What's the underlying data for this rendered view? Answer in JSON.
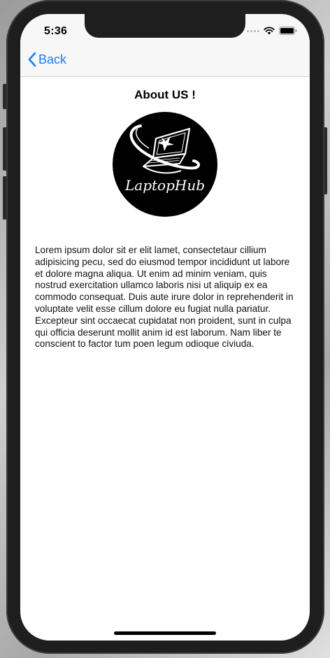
{
  "status_bar": {
    "time": "5:36"
  },
  "nav": {
    "back_label": "Back"
  },
  "page": {
    "title": "About US !",
    "logo_text": "LaptopHub",
    "description": "Lorem ipsum dolor sit er elit lamet, consectetaur cillium adipisicing pecu, sed do eiusmod tempor incididunt ut labore et dolore magna aliqua. Ut enim ad minim veniam, quis nostrud exercitation ullamco laboris nisi ut aliquip ex ea commodo consequat. Duis aute irure dolor in reprehenderit in voluptate velit esse cillum dolore eu fugiat nulla pariatur. Excepteur sint occaecat cupidatat non proident, sunt in culpa qui officia deserunt mollit anim id est laborum. Nam liber te conscient to factor tum poen legum odioque civiuda."
  },
  "icons": {
    "back": "chevron-left-icon",
    "wifi": "wifi-icon",
    "battery": "battery-icon",
    "signal": "signal-icon"
  },
  "colors": {
    "accent": "#1a7ff5",
    "nav_background": "#f7f7f7",
    "logo_background": "#000000"
  }
}
